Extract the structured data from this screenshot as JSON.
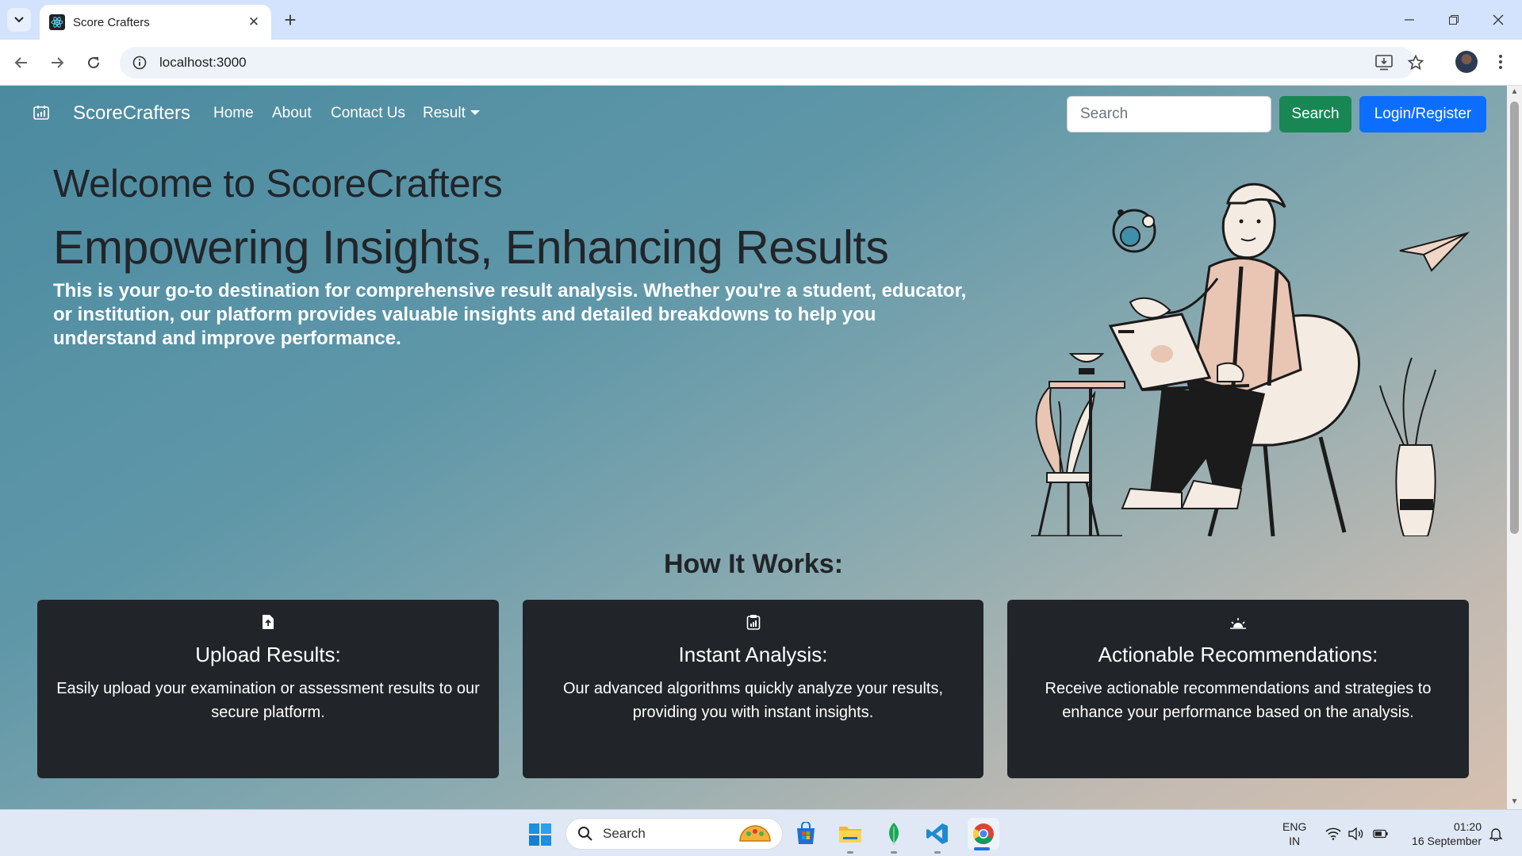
{
  "browser": {
    "tab_title": "Score Crafters",
    "url": "localhost:3000"
  },
  "navbar": {
    "brand": "ScoreCrafters",
    "links": [
      "Home",
      "About",
      "Contact Us",
      "Result"
    ],
    "search_placeholder": "Search",
    "search_button": "Search",
    "login_button": "Login/Register"
  },
  "hero": {
    "title": "Welcome to ScoreCrafters",
    "subtitle": "Empowering Insights, Enhancing Results",
    "description": "This is your go-to destination for comprehensive result analysis. Whether you're a student, educator, or institution, our platform provides valuable insights and detailed breakdowns to help you understand and improve performance."
  },
  "how_it_works": {
    "title": "How It Works:",
    "cards": [
      {
        "icon": "file-upload-icon",
        "title": "Upload Results:",
        "text": "Easily upload your examination or assessment results to our secure platform."
      },
      {
        "icon": "clipboard-chart-icon",
        "title": "Instant Analysis:",
        "text": "Our advanced algorithms quickly analyze your results, providing you with instant insights."
      },
      {
        "icon": "sunrise-icon",
        "title": "Actionable Recommendations:",
        "text": "Receive actionable recommendations and strategies to enhance your performance based on the analysis."
      }
    ]
  },
  "taskbar": {
    "search_label": "Search",
    "lang_line1": "ENG",
    "lang_line2": "IN",
    "time": "01:20",
    "date": "16 September"
  },
  "colors": {
    "search_button": "#198754",
    "login_button": "#0d6efd",
    "card_bg": "#212529"
  }
}
